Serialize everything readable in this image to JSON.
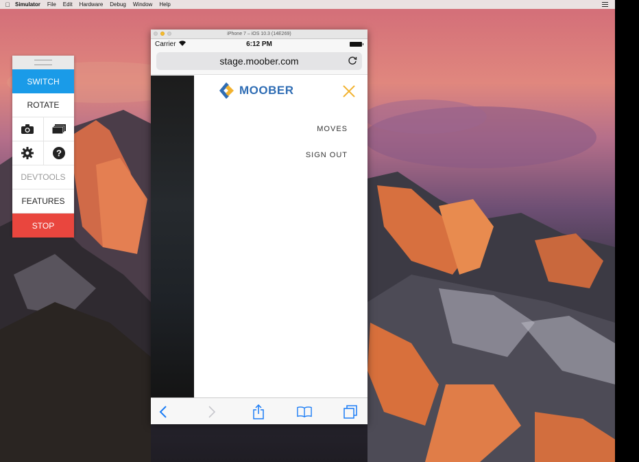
{
  "menubar": {
    "app_name": "Simulator",
    "items": [
      "File",
      "Edit",
      "Hardware",
      "Debug",
      "Window",
      "Help"
    ]
  },
  "panel": {
    "switch_label": "SWITCH",
    "rotate_label": "ROTATE",
    "devtools_label": "DEVTOOLS",
    "features_label": "FEATURES",
    "stop_label": "STOP",
    "colors": {
      "switch": "#1a9be8",
      "stop": "#e9463e"
    }
  },
  "simulator": {
    "window_title": "iPhone 7 – iOS 10.3 (14E269)",
    "status": {
      "carrier": "Carrier",
      "time": "6:12 PM"
    },
    "url": "stage.moober.com",
    "app": {
      "logo_text": "MOOBER",
      "menu_items": [
        "MOVES",
        "SIGN OUT"
      ],
      "brand_colors": {
        "logo": "#2f6db4",
        "close": "#f2b22f"
      }
    }
  },
  "icons": [
    "apple-icon",
    "list-icon",
    "camera-icon",
    "gallery-icon",
    "gear-icon",
    "help-icon",
    "wifi-icon",
    "battery-icon",
    "reload-icon",
    "moober-logo-icon",
    "close-icon",
    "back-icon",
    "forward-icon",
    "share-icon",
    "bookmarks-icon",
    "tabs-icon"
  ]
}
